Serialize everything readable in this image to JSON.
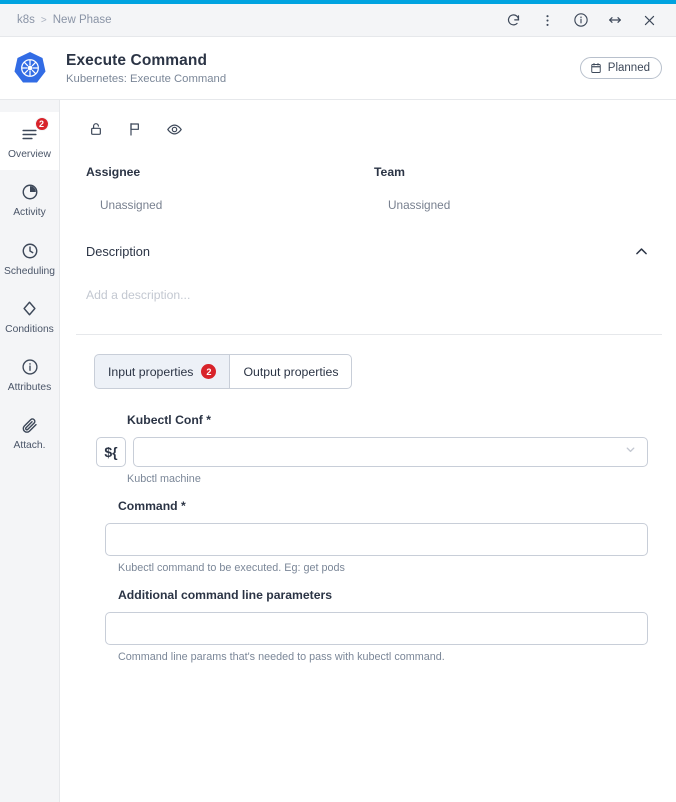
{
  "window": {
    "accent_color": "#00a3e0",
    "breadcrumb": {
      "root": "k8s",
      "separator": ">",
      "current": "New Phase"
    },
    "actions": [
      {
        "name": "refresh",
        "label": "Refresh",
        "icon": "refresh-icon"
      },
      {
        "name": "more",
        "label": "More options",
        "icon": "more-vertical-icon"
      },
      {
        "name": "info",
        "label": "Info",
        "icon": "info-circle-icon"
      },
      {
        "name": "resize",
        "label": "Resize",
        "icon": "arrows-horizontal-icon"
      },
      {
        "name": "close",
        "label": "Close",
        "icon": "close-icon"
      }
    ]
  },
  "header": {
    "logo": "kubernetes-logo",
    "title": "Execute Command",
    "subtitle": "Kubernetes: Execute Command",
    "status": {
      "label": "Planned",
      "icon": "calendar-icon"
    }
  },
  "sidebar": {
    "items": [
      {
        "label": "Overview",
        "icon": "list-icon",
        "badge": "2",
        "active": true
      },
      {
        "label": "Activity",
        "icon": "pie-clock-icon",
        "badge": null,
        "active": false
      },
      {
        "label": "Scheduling",
        "icon": "clock-icon",
        "badge": null,
        "active": false
      },
      {
        "label": "Conditions",
        "icon": "diamond-icon",
        "badge": null,
        "active": false
      },
      {
        "label": "Attributes",
        "icon": "info-circle-icon",
        "badge": null,
        "active": false
      },
      {
        "label": "Attach.",
        "icon": "paperclip-icon",
        "badge": null,
        "active": false
      }
    ]
  },
  "toolbar": {
    "icons": [
      {
        "name": "lock-icon",
        "label": "Lock"
      },
      {
        "name": "flag-icon",
        "label": "Flag"
      },
      {
        "name": "eye-icon",
        "label": "Watch"
      }
    ]
  },
  "meta": {
    "assignee": {
      "label": "Assignee",
      "value": "Unassigned"
    },
    "team": {
      "label": "Team",
      "value": "Unassigned"
    }
  },
  "description": {
    "title": "Description",
    "placeholder": "Add a description...",
    "collapse_icon": "chevron-up-icon",
    "expanded": true
  },
  "tabs": [
    {
      "label": "Input properties",
      "badge": "2",
      "active": true
    },
    {
      "label": "Output properties",
      "badge": null,
      "active": false
    }
  ],
  "form": {
    "fields": [
      {
        "label": "Kubectl Conf",
        "required": true,
        "required_marker": "*",
        "type": "select",
        "value": "",
        "placeholder": "",
        "helper": "Kubctl machine",
        "has_variable_button": true,
        "variable_button_label": "${",
        "caret_icon": "chevron-down-icon"
      },
      {
        "label": "Command",
        "required": true,
        "required_marker": "*",
        "type": "text",
        "value": "",
        "placeholder": "",
        "helper": "Kubectl command to be executed. Eg: get pods",
        "has_variable_button": false
      },
      {
        "label": "Additional command line parameters",
        "required": false,
        "required_marker": "",
        "type": "text",
        "value": "",
        "placeholder": "",
        "helper": "Command line params that's needed to pass with kubectl command.",
        "has_variable_button": false
      }
    ]
  },
  "colors": {
    "accent": "#00a3e0",
    "badge_red": "#d8232a",
    "k8s_blue": "#326ce5",
    "text_dark": "#2b3445",
    "text_muted": "#7b8798",
    "panel_bg": "#f4f5f7",
    "border": "#e6e8eb"
  }
}
